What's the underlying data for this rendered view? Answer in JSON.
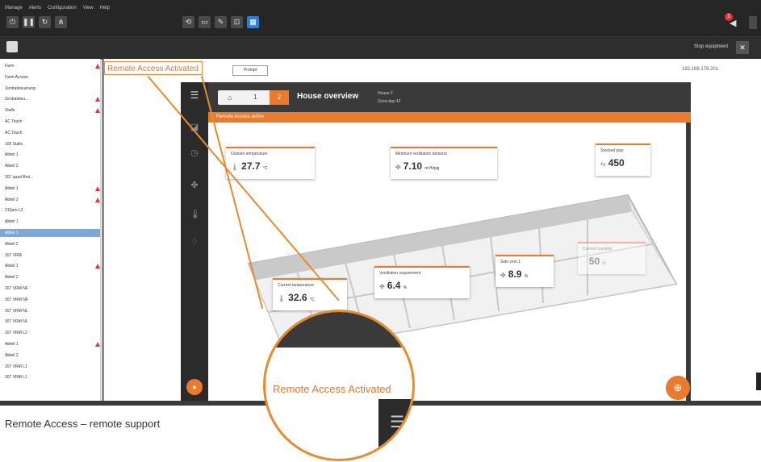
{
  "top_toolbar": {
    "menu": [
      "Manage",
      "Alerts",
      "Configuration",
      "View",
      "Help"
    ],
    "buttons": [
      {
        "icon": "power-icon",
        "x": 0
      },
      {
        "icon": "pause-icon"
      },
      {
        "icon": "refresh-icon"
      },
      {
        "icon": "tree-icon"
      },
      {
        "icon": "reset-icon"
      },
      {
        "icon": "monitor-icon"
      },
      {
        "icon": "wrench-icon"
      },
      {
        "icon": "screenshot-icon"
      },
      {
        "icon": "grid-icon"
      }
    ],
    "notification_count": "1"
  },
  "second_bar": {
    "stop_equipment_label": "Stop equipment"
  },
  "tree": {
    "items": [
      {
        "label": "Farm",
        "alarm": true
      },
      {
        "label": "Farm Access",
        "alarm": false
      },
      {
        "label": "Zentralsteuerung",
        "alarm": false
      },
      {
        "label": "Zentralsteu...",
        "alarm": true
      },
      {
        "label": "Stalls",
        "alarm": true
      },
      {
        "label": "AC Touch",
        "alarm": false
      },
      {
        "label": "AC Touch",
        "alarm": false
      },
      {
        "label": "105 Stalls",
        "alarm": false
      },
      {
        "label": "Abteil 1",
        "alarm": false
      },
      {
        "label": "Abteil 2",
        "alarm": false
      },
      {
        "label": "207 quad Broi...",
        "alarm": false
      },
      {
        "label": "Abteil 1",
        "alarm": true
      },
      {
        "label": "Abteil 2",
        "alarm": true
      },
      {
        "label": "210pro L2",
        "alarm": false
      },
      {
        "label": "Abteil 1",
        "alarm": false
      },
      {
        "label": "Abteil 1",
        "alarm": false,
        "selected": true
      },
      {
        "label": "Abteil 2",
        "alarm": false
      },
      {
        "label": "207 VRM",
        "alarm": false
      },
      {
        "label": "Abteil 1",
        "alarm": true
      },
      {
        "label": "Abteil 2",
        "alarm": false
      },
      {
        "label": "207 VRM NF",
        "alarm": false
      },
      {
        "label": "307 VRM NF",
        "alarm": false
      },
      {
        "label": "207 VRM NL",
        "alarm": false
      },
      {
        "label": "307 VRM NL",
        "alarm": false
      },
      {
        "label": "207 VRM L2",
        "alarm": false
      },
      {
        "label": "Abteil 1",
        "alarm": true
      },
      {
        "label": "Abteil 2",
        "alarm": false
      },
      {
        "label": "207 VRM L1",
        "alarm": false
      },
      {
        "label": "307 VRM L1",
        "alarm": false
      }
    ]
  },
  "content": {
    "remote_access_label": "Remote Access Activated",
    "prompt_chip": "Prompt",
    "ip_address": "192.168.178.201"
  },
  "app": {
    "seg_home": "⌂",
    "seg_1": "1",
    "seg_active": "2",
    "title": "House overview",
    "sub1": "House 2",
    "sub2": "Grow day 42",
    "banner": "Remote Access active",
    "cards": [
      {
        "title": "Outside temperature",
        "value": "27.7",
        "unit": "°C",
        "icon": "thermometer-icon"
      },
      {
        "title": "Minimum ventilation demand",
        "value": "7.10",
        "unit": "m³/h/pig",
        "icon": "fan-icon"
      },
      {
        "title": "Stocked pigs",
        "value": "450",
        "unit": "",
        "icon": "pig-icon"
      },
      {
        "title": "Current temperature",
        "value": "32.6",
        "unit": "°C",
        "icon": "thermometer-icon"
      },
      {
        "title": "Ventilation requirement",
        "value": "6.4",
        "unit": "%",
        "icon": "fan-icon"
      },
      {
        "title": "Side vent 1",
        "value": "8.9",
        "unit": "%",
        "icon": "fan-icon"
      },
      {
        "title": "Current humidity",
        "value": "50",
        "unit": "%",
        "icon": "humidity-icon"
      }
    ]
  },
  "caption": "Remote Access – remote support",
  "magnifier": {
    "text": "Remote Access Activated"
  },
  "colors": {
    "accent": "#ea7a2c",
    "dark": "#2b2b2b"
  }
}
